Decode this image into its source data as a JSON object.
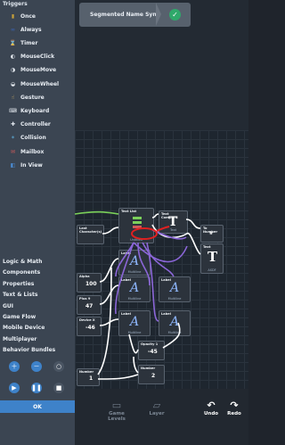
{
  "sidebar": {
    "title": "Triggers",
    "triggers": [
      {
        "label": "Once",
        "icon": "once-icon",
        "color": "#c7a03a"
      },
      {
        "label": "Always",
        "icon": "always-icon",
        "color": "#3a5fa8"
      },
      {
        "label": "Timer",
        "icon": "timer-icon",
        "color": "#7b5aa8"
      },
      {
        "label": "MouseClick",
        "icon": "mouse-click-icon",
        "color": "#e8edf3"
      },
      {
        "label": "MouseMove",
        "icon": "mouse-move-icon",
        "color": "#e8edf3"
      },
      {
        "label": "MouseWheel",
        "icon": "mouse-wheel-icon",
        "color": "#e8edf3"
      },
      {
        "label": "Gesture",
        "icon": "gesture-icon",
        "color": "#d2b065"
      },
      {
        "label": "Keyboard",
        "icon": "keyboard-icon",
        "color": "#e8edf3"
      },
      {
        "label": "Controller",
        "icon": "controller-icon",
        "color": "#e8edf3"
      },
      {
        "label": "Collision",
        "icon": "collision-icon",
        "color": "#5aa0c8"
      },
      {
        "label": "Mailbox",
        "icon": "mailbox-icon",
        "color": "#c85a5a"
      },
      {
        "label": "In View",
        "icon": "in-view-icon",
        "color": "#4a8ad0"
      }
    ],
    "categories": [
      "Logic & Math",
      "Components",
      "Properties",
      "Text & Lists",
      "GUI",
      "Game Flow",
      "Mobile Device",
      "Multiplayer",
      "Behavior Bundles"
    ],
    "ok_label": "OK"
  },
  "sync": {
    "title": "Segmented Name Sync",
    "status_color": "#2fa86a"
  },
  "nodes": {
    "text_list": {
      "title": "Text List",
      "foot": "Untitled"
    },
    "text_compare": {
      "title": "Text Compare",
      "foot": "Text"
    },
    "to_number": {
      "title": "To Number"
    },
    "text_node": {
      "title": "Text",
      "foot": "ASDF"
    },
    "last_character": {
      "title": "Last Character(s)"
    },
    "alpha": {
      "title": "Alpha",
      "value": "100"
    },
    "plus9": {
      "title": "Plus 9",
      "value": "47"
    },
    "device_x": {
      "title": "Device X",
      "value": "-46"
    },
    "label1": {
      "title": "Label",
      "foot": "Multiline"
    },
    "label2": {
      "title": "Label",
      "foot": "Multiline"
    },
    "label3": {
      "title": "Label",
      "foot": "Multiline"
    },
    "label4": {
      "title": "Label",
      "foot": "Multiline"
    },
    "label5": {
      "title": "Label",
      "foot": "Multiline"
    },
    "opacity": {
      "title": "Opacity 1",
      "value": "-45"
    },
    "number1": {
      "title": "Number",
      "value": "1"
    },
    "number2": {
      "title": "Number",
      "value": "2"
    }
  },
  "bottom_nav": {
    "items": [
      {
        "label": "Game Levels",
        "icon": "game-levels-icon"
      },
      {
        "label": "Layer",
        "icon": "layer-icon"
      },
      {
        "label": "Undo",
        "icon": "undo-icon"
      },
      {
        "label": "Redo",
        "icon": "redo-icon"
      }
    ]
  },
  "colors": {
    "accent": "#3e82c9",
    "wire_purple": "#8b66d8",
    "wire_white": "#ffffff",
    "wire_green": "#7bd05a",
    "highlight_red": "#e02020"
  }
}
